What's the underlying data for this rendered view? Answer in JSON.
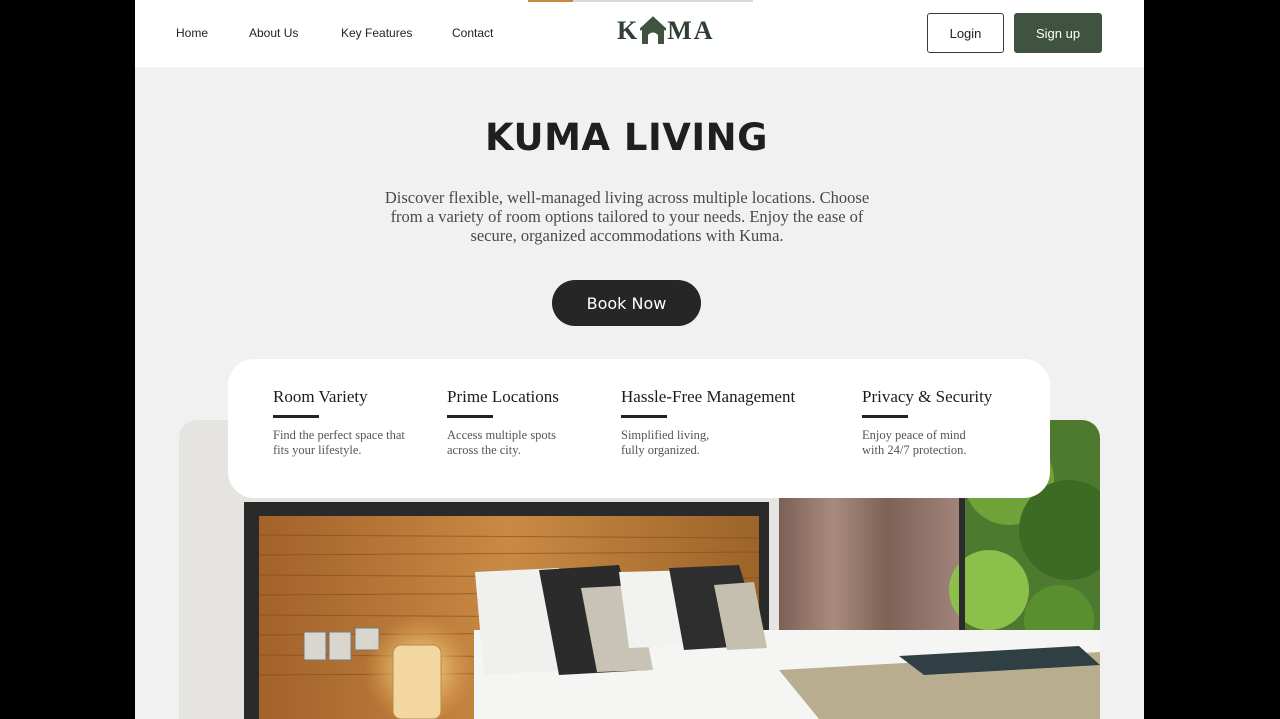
{
  "nav": {
    "links": [
      "Home",
      "About Us",
      "Key Features",
      "Contact"
    ],
    "logo": {
      "before": "K",
      "after": "MA"
    },
    "login_label": "Login",
    "signup_label": "Sign up"
  },
  "hero": {
    "title": "KUMA LIVING",
    "description": "Discover flexible, well-managed living across multiple locations. Choose from a variety of room options tailored to your needs. Enjoy the ease of secure, organized accommodations with Kuma.",
    "cta_label": "Book Now"
  },
  "features": [
    {
      "title": "Room Variety",
      "description": "Find the perfect space that fits your lifestyle."
    },
    {
      "title": "Prime Locations",
      "description": "Access multiple spots across the city."
    },
    {
      "title": "Hassle-Free Management",
      "description": "Simplified living, fully organized."
    },
    {
      "title": "Privacy & Security",
      "description": "Enjoy peace of mind with 24/7 protection."
    }
  ],
  "colors": {
    "brand_green": "#3f5340",
    "cta_dark": "#262626",
    "page_bg": "#f1f1f1",
    "accent_strip": "#c58a3d"
  },
  "icons": [
    "house-logo-icon"
  ]
}
